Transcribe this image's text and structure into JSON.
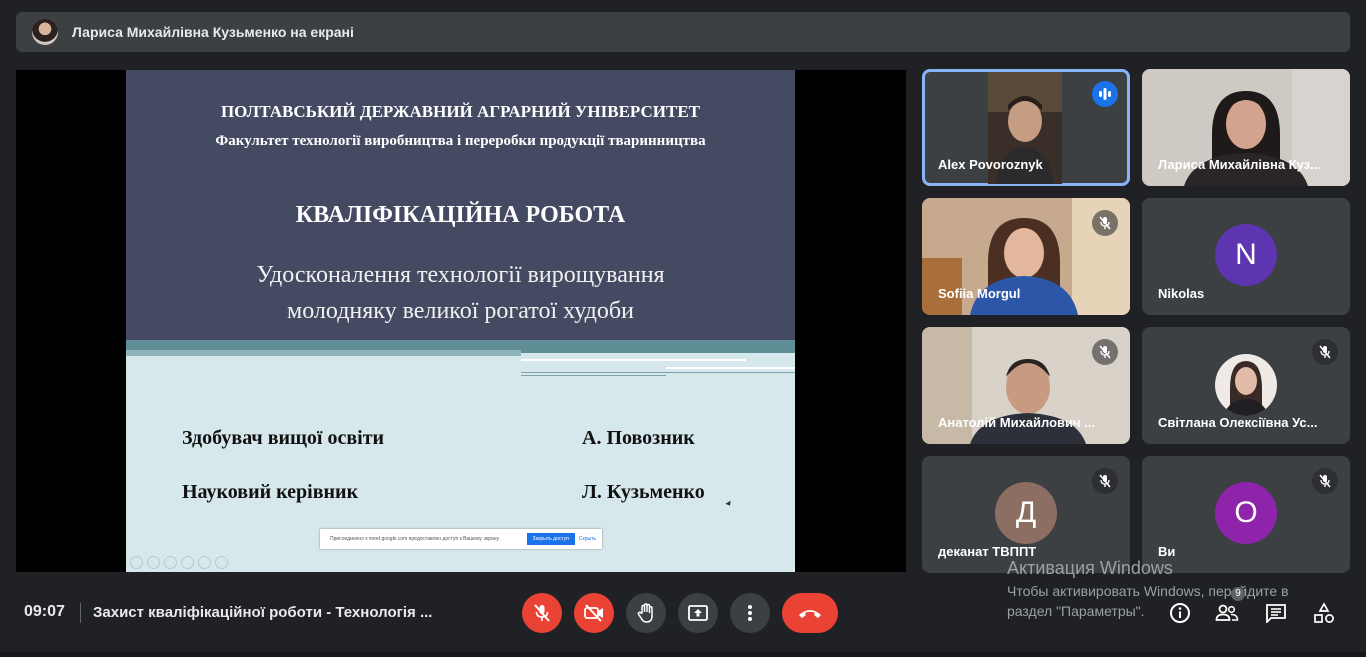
{
  "banner": {
    "text": "Лариса Михайлівна Кузьменко на екрані"
  },
  "slide": {
    "university": "ПОЛТАВСЬКИЙ ДЕРЖАВНИЙ АГРАРНИЙ УНІВЕРСИТЕТ",
    "faculty": "Факультет технології виробництва і переробки продукції тваринництва",
    "title": "КВАЛІФІКАЦІЙНА РОБОТА",
    "subtitle_line1": "Удосконалення технології вирощування",
    "subtitle_line2": "молодняку великої рогатої худоби",
    "row1_label": "Здобувач вищої освіти",
    "row1_name": "А. Повозник",
    "row2_label": "Науковий керівник",
    "row2_name": "Л. Кузьменко",
    "share_notice": "Присоединено к meet.google.com предоставлен доступ к Вашему экрану",
    "stop_sharing": "Закрыть доступ",
    "hide": "Скрыть"
  },
  "participants": [
    {
      "name": "Alex Povoroznyk",
      "state": "speaking",
      "avatar_letter": "",
      "avatar_color": ""
    },
    {
      "name": "Лариса Михайлівна Куз...",
      "state": "video",
      "avatar_letter": "",
      "avatar_color": ""
    },
    {
      "name": "Sofiia Morgul",
      "state": "muted",
      "avatar_letter": "",
      "avatar_color": ""
    },
    {
      "name": "Nikolas",
      "state": "no-video",
      "avatar_letter": "N",
      "avatar_color": "#5e35b1"
    },
    {
      "name": "Анатолій Михайлович ...",
      "state": "muted",
      "avatar_letter": "",
      "avatar_color": ""
    },
    {
      "name": "Світлана Олексіївна Ус...",
      "state": "muted",
      "avatar_letter": "",
      "avatar_color": ""
    },
    {
      "name": "деканат ТВППТ",
      "state": "muted",
      "avatar_letter": "Д",
      "avatar_color": "#8d6e63"
    },
    {
      "name": "Ви",
      "state": "muted",
      "avatar_letter": "О",
      "avatar_color": "#8e24aa"
    }
  ],
  "bottom": {
    "time": "09:07",
    "meeting_title": "Захист кваліфікаційної роботи - Технологія ...",
    "people_count": "9"
  },
  "watermark": {
    "line1": "Активация Windows",
    "line2": "Чтобы активировать Windows, перейдите в",
    "line3": "раздел \"Параметры\"."
  },
  "colors": {
    "accent": "#8ab4f8",
    "danger": "#ea4335",
    "tile": "#3c4043",
    "bg": "#202124"
  }
}
